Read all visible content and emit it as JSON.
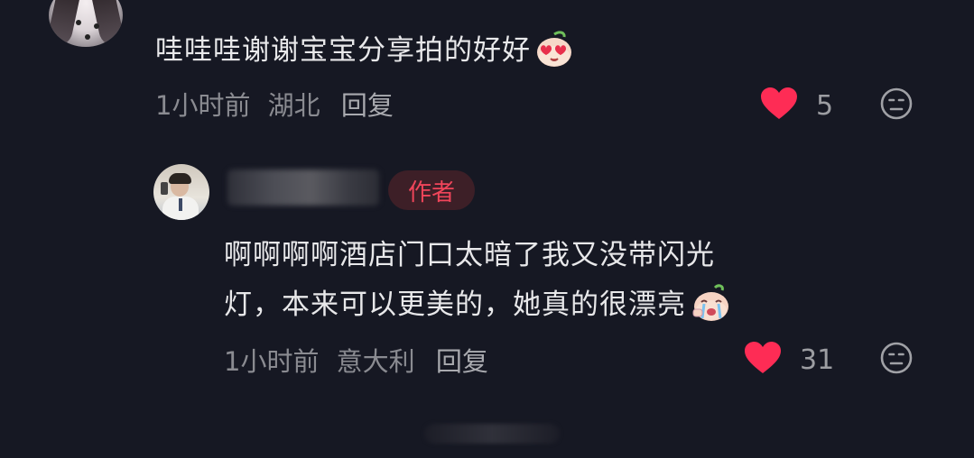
{
  "comments": [
    {
      "text": "哇哇哇谢谢宝宝分享拍的好好",
      "emoji": "heart-eyes-peach-emoji",
      "time": "1小时前",
      "location": "湖北",
      "reply_label": "回复",
      "likes": "5"
    }
  ],
  "reply": {
    "author_badge": "作者",
    "text_line1": "啊啊啊啊酒店门口太暗了我又没带闪光",
    "text_line2": "灯，本来可以更美的，她真的很漂亮",
    "emoji": "crying-peach-emoji",
    "time": "1小时前",
    "location": "意大利",
    "reply_label": "回复",
    "likes": "31"
  },
  "colors": {
    "background": "#161823",
    "like_red": "#fe2c55",
    "badge_text": "#f0455a",
    "badge_bg": "#3d1f27",
    "meta_gray": "#8a8b91"
  },
  "icons": [
    "heart-icon",
    "dislike-face-icon"
  ]
}
